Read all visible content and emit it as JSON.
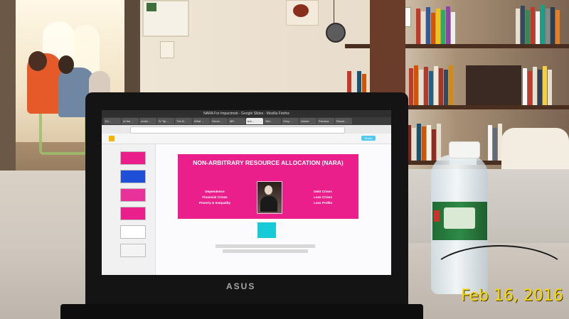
{
  "browser": {
    "window_title": "NARA For Impactmob - Google Slides - Mozilla Firefox",
    "tabs": [
      "Ex…",
      "Al the…",
      "under…",
      "IV Tip…",
      "The B…",
      "What …",
      "Geom…",
      "ME…",
      "but…",
      "Sild…",
      "Grey…",
      "Adobe",
      "Preview",
      "Result…"
    ],
    "share_label": "Share"
  },
  "slide": {
    "title": "NON-ARBITRARY RESOURCE ALLOCATION (NARA)",
    "left_items": [
      "Dependence",
      "Financial Crises",
      "Poverty & Inequality"
    ],
    "right_items": [
      "Debt Crises",
      "Loss Crises",
      "Loss Profits"
    ]
  },
  "laptop": {
    "brand": "ASUS"
  },
  "photo": {
    "date_stamp": "Feb 16, 2016"
  },
  "colors": {
    "slide_bg": "#ea1f8b",
    "accent_box": "#18c9d8",
    "date_stamp": "#f5d800"
  }
}
